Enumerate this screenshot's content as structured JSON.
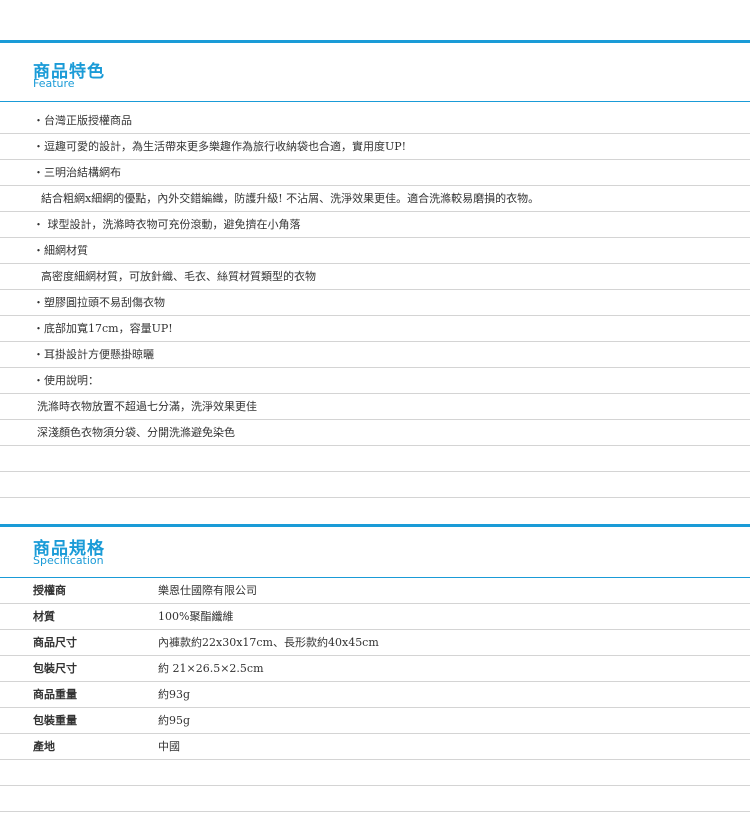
{
  "feature": {
    "title": "商品特色",
    "subtitle": "Feature",
    "items": [
      "・台灣正版授權商品",
      "・逗趣可愛的設計，為生活帶來更多樂趣作為旅行收納袋也合適，實用度UP!",
      "・三明治結構網布",
      "結合粗網x細網的優點，內外交錯編織，防護升級! 不沾屑、洗淨效果更佳。適合洗滌較易磨損的衣物。",
      "・ 球型設計，洗滌時衣物可充份滾動，避免擠在小角落",
      "・細網材質",
      "高密度細網材質，可放針織、毛衣、絲質材質類型的衣物",
      "・塑膠圓拉頭不易刮傷衣物",
      "・底部加寬17cm，容量UP!",
      "・耳掛設計方便懸掛晾曬",
      "・使用說明：",
      "洗滌時衣物放置不超過七分滿，洗淨效果更佳",
      "深淺顏色衣物須分袋、分開洗滌避免染色",
      "",
      ""
    ]
  },
  "spec": {
    "title": "商品規格",
    "subtitle": "Specification",
    "rows": [
      {
        "label": "授權商",
        "value": "樂恩仕國際有限公司"
      },
      {
        "label": "材質",
        "value": "100%聚酯纖維"
      },
      {
        "label": "商品尺寸",
        "value": "內褲款約22x30x17cm、長形款約40x45cm"
      },
      {
        "label": "包裝尺寸",
        "value": "約 21×26.5×2.5cm"
      },
      {
        "label": "商品重量",
        "value": "約93g"
      },
      {
        "label": "包裝重量",
        "value": "約95g"
      },
      {
        "label": "產地",
        "value": "中國"
      },
      {
        "label": "",
        "value": ""
      },
      {
        "label": "",
        "value": ""
      }
    ]
  },
  "colors": {
    "accent": "#1a9bd7",
    "rule": "#d4d4d4",
    "text": "#333333"
  }
}
